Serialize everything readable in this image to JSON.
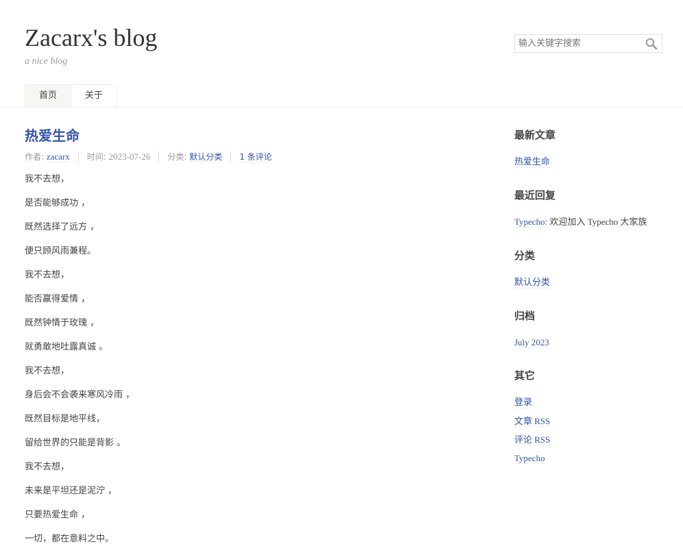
{
  "site": {
    "title": "Zacarx's blog",
    "description": "a nice blog"
  },
  "search": {
    "placeholder": "输入关键字搜索",
    "icon": "search-icon"
  },
  "nav": {
    "items": [
      {
        "label": "首页"
      },
      {
        "label": "关于"
      }
    ]
  },
  "post": {
    "title": "热爱生命",
    "meta": {
      "author_label": "作者: ",
      "author": "zacarx",
      "time_label": "时间: ",
      "time": "2023-07-26",
      "category_label": "分类: ",
      "category": "默认分类",
      "comments": "1 条评论"
    },
    "lines": [
      "我不去想，",
      "是否能够成功 ，",
      "既然选择了远方 ，",
      "便只顾风雨兼程。",
      "我不去想，",
      "能否赢得爱情 ，",
      "既然钟情于玫瑰 ，",
      "就勇敢地吐露真诚 。",
      "我不去想，",
      "身后会不会袭来寒风冷雨 ，",
      "既然目标是地平线，",
      "留给世界的只能是背影 。",
      "我不去想，",
      "未来是平坦还是泥泞 ，",
      "只要热爱生命 ，",
      "一切，都在意料之中。"
    ]
  },
  "sidebar": {
    "recent_posts": {
      "title": "最新文章",
      "items": [
        "热爱生命"
      ]
    },
    "recent_comments": {
      "title": "最近回复",
      "author": "Typecho",
      "text": ": 欢迎加入 Typecho 大家族"
    },
    "categories": {
      "title": "分类",
      "items": [
        "默认分类"
      ]
    },
    "archives": {
      "title": "归档",
      "items": [
        "July 2023"
      ]
    },
    "other": {
      "title": "其它",
      "items": [
        "登录",
        "文章 RSS",
        "评论 RSS",
        "Typecho"
      ]
    }
  },
  "colors": {
    "link": "#3354aa",
    "text": "#444444",
    "muted": "#999999"
  }
}
